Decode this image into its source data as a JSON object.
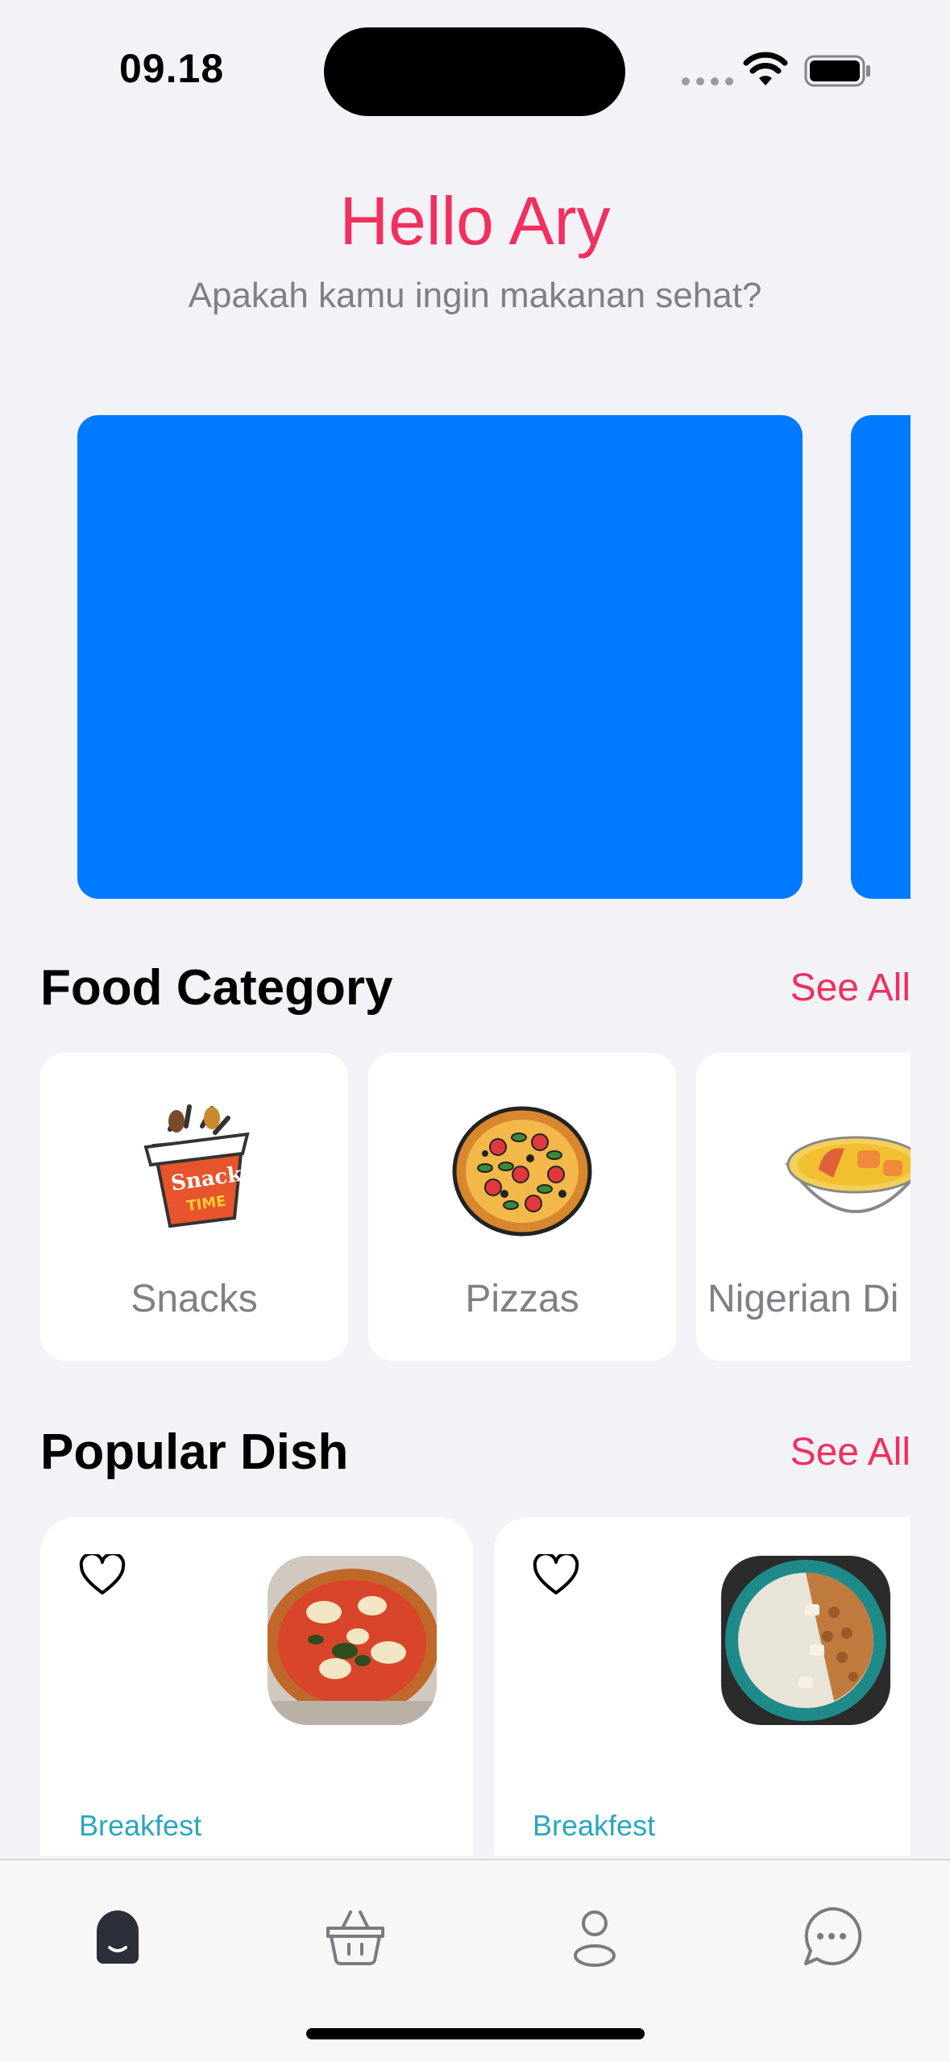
{
  "status_bar": {
    "time": "09.18",
    "icons": [
      "signal-dots-icon",
      "wifi-icon",
      "battery-icon"
    ]
  },
  "header": {
    "greeting": "Hello Ary",
    "subtitle": "Apakah kamu ingin makanan sehat?"
  },
  "banners": {
    "count_visible": 2,
    "color": "#007aff"
  },
  "food_category": {
    "title": "Food Category",
    "see_all": "See All",
    "items": [
      {
        "label": "Snacks",
        "icon": "snack-time-icon"
      },
      {
        "label": "Pizzas",
        "icon": "pizza-icon"
      },
      {
        "label": "Nigerian Di",
        "icon": "nigerian-dish-icon"
      }
    ]
  },
  "popular_dish": {
    "title": "Popular Dish",
    "see_all": "See All",
    "items": [
      {
        "tag": "Breakfest",
        "image": "pizza-photo",
        "favorite_icon": "heart-outline-icon"
      },
      {
        "tag": "Breakfest",
        "image": "grain-bowl-photo",
        "favorite_icon": "heart-outline-icon"
      }
    ]
  },
  "tab_bar": {
    "tabs": [
      {
        "icon": "home-icon",
        "active": true
      },
      {
        "icon": "basket-icon",
        "active": false
      },
      {
        "icon": "profile-icon",
        "active": false
      },
      {
        "icon": "chat-icon",
        "active": false
      }
    ]
  },
  "colors": {
    "accent": "#f0305e",
    "banner": "#007aff",
    "tag": "#2aa7bf",
    "background": "#f2f2f7"
  }
}
